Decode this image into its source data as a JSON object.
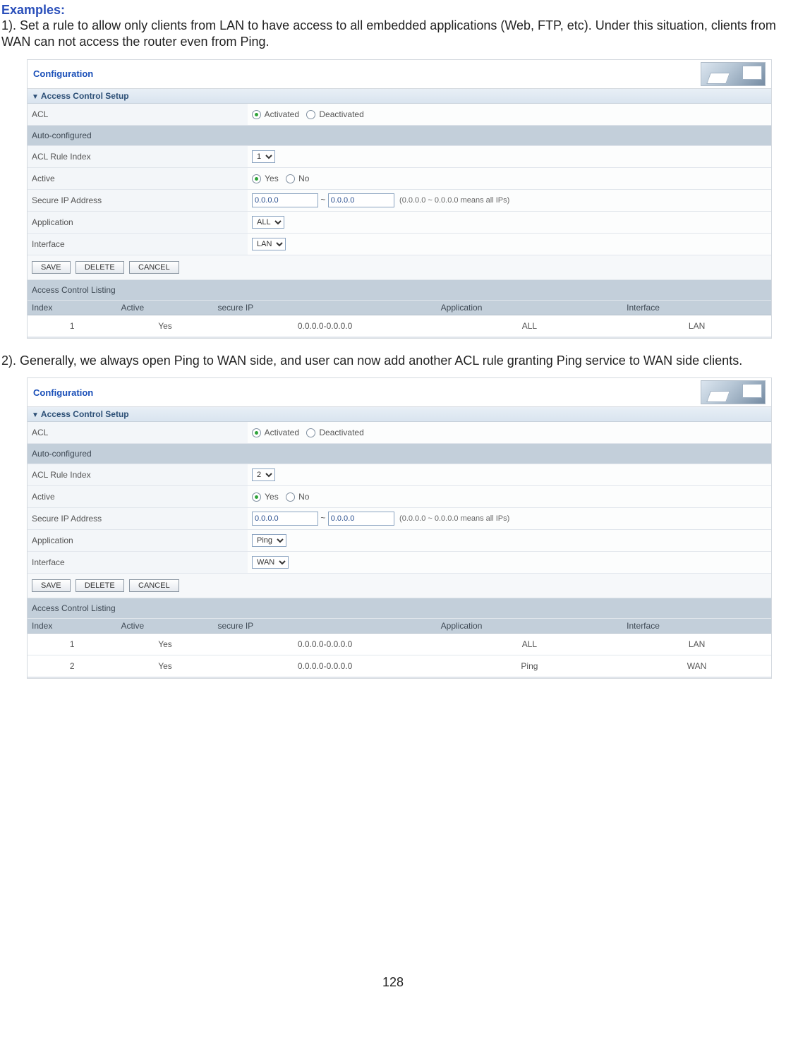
{
  "heading": "Examples:",
  "para1": "1). Set a rule to allow only clients from LAN to have access to all embedded applications (Web, FTP, etc). Under this situation, clients from WAN can not access the router even from Ping.",
  "para2": "2). Generally, we always open Ping to WAN side, and user can now add another ACL rule granting Ping service to WAN side clients.",
  "page_num": "128",
  "panel": {
    "title": "Configuration",
    "section": "Access Control Setup",
    "auto_cfg": "Auto-configured",
    "labels": {
      "acl": "ACL",
      "rule_index": "ACL Rule Index",
      "active": "Active",
      "secure_ip": "Secure IP Address",
      "application": "Application",
      "interface": "Interface"
    },
    "radios": {
      "activated": "Activated",
      "deactivated": "Deactivated",
      "yes": "Yes",
      "no": "No"
    },
    "ip_hint": "(0.0.0.0 ~ 0.0.0.0 means all IPs)",
    "ip_tilde": "~",
    "buttons": {
      "save": "SAVE",
      "delete": "DELETE",
      "cancel": "CANCEL"
    },
    "listing_title": "Access Control Listing",
    "listing_headers": {
      "index": "Index",
      "active": "Active",
      "secure_ip": "secure IP",
      "application": "Application",
      "interface": "Interface"
    }
  },
  "ex1": {
    "rule_index": "1",
    "ip_from": "0.0.0.0",
    "ip_to": "0.0.0.0",
    "application": "ALL",
    "interface": "LAN",
    "rows": [
      {
        "index": "1",
        "active": "Yes",
        "secure_ip": "0.0.0.0-0.0.0.0",
        "application": "ALL",
        "interface": "LAN"
      }
    ]
  },
  "ex2": {
    "rule_index": "2",
    "ip_from": "0.0.0.0",
    "ip_to": "0.0.0.0",
    "application": "Ping",
    "interface": "WAN",
    "rows": [
      {
        "index": "1",
        "active": "Yes",
        "secure_ip": "0.0.0.0-0.0.0.0",
        "application": "ALL",
        "interface": "LAN"
      },
      {
        "index": "2",
        "active": "Yes",
        "secure_ip": "0.0.0.0-0.0.0.0",
        "application": "Ping",
        "interface": "WAN"
      }
    ]
  }
}
